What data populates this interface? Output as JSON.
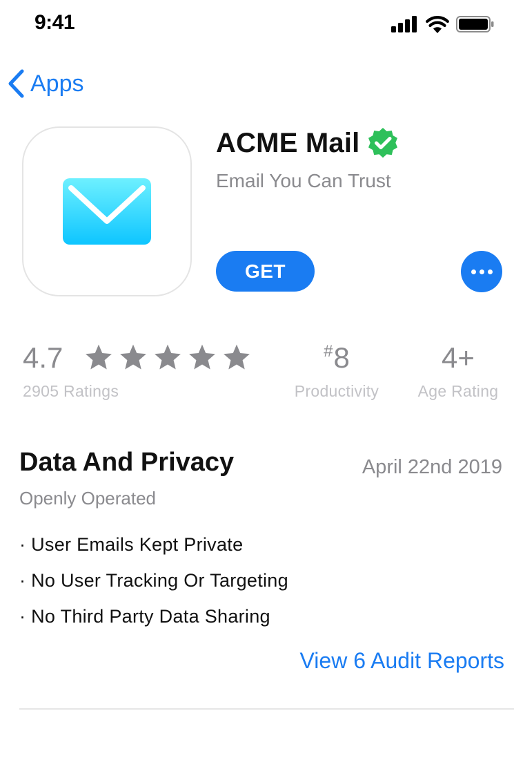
{
  "status_bar": {
    "time": "9:41",
    "icons": [
      "cellular-signal-icon",
      "wifi-icon",
      "battery-icon"
    ]
  },
  "nav": {
    "back_label": "Apps",
    "back_icon": "chevron-left-icon"
  },
  "app": {
    "icon": "envelope-icon",
    "name": "ACME Mail",
    "verified_icon": "verified-badge-icon",
    "subtitle": "Email You Can Trust",
    "get_label": "GET",
    "more_icon": "ellipsis-icon"
  },
  "stats": {
    "rating": "4.7",
    "stars_filled": 5,
    "stars_total": 5,
    "rating_count": "2905 Ratings",
    "rank_symbol": "#",
    "rank_number": "8",
    "rank_label": "Productivity",
    "age_value": "4+",
    "age_label": "Age Rating"
  },
  "privacy": {
    "title": "Data And Privacy",
    "date": "April 22nd 2019",
    "subtitle": "Openly Operated",
    "items": [
      "· User Emails Kept Private",
      "· No User Tracking Or Targeting",
      "· No Third Party Data Sharing"
    ],
    "audit_link": "View 6 Audit Reports"
  },
  "colors": {
    "accent": "#1a7cf2",
    "verified": "#2ec05a",
    "secondary_text": "#8a8a8e",
    "tertiary_text": "#c2c2c6",
    "envelope_top": "#6ef0ff",
    "envelope_bottom": "#0ec5ff"
  }
}
